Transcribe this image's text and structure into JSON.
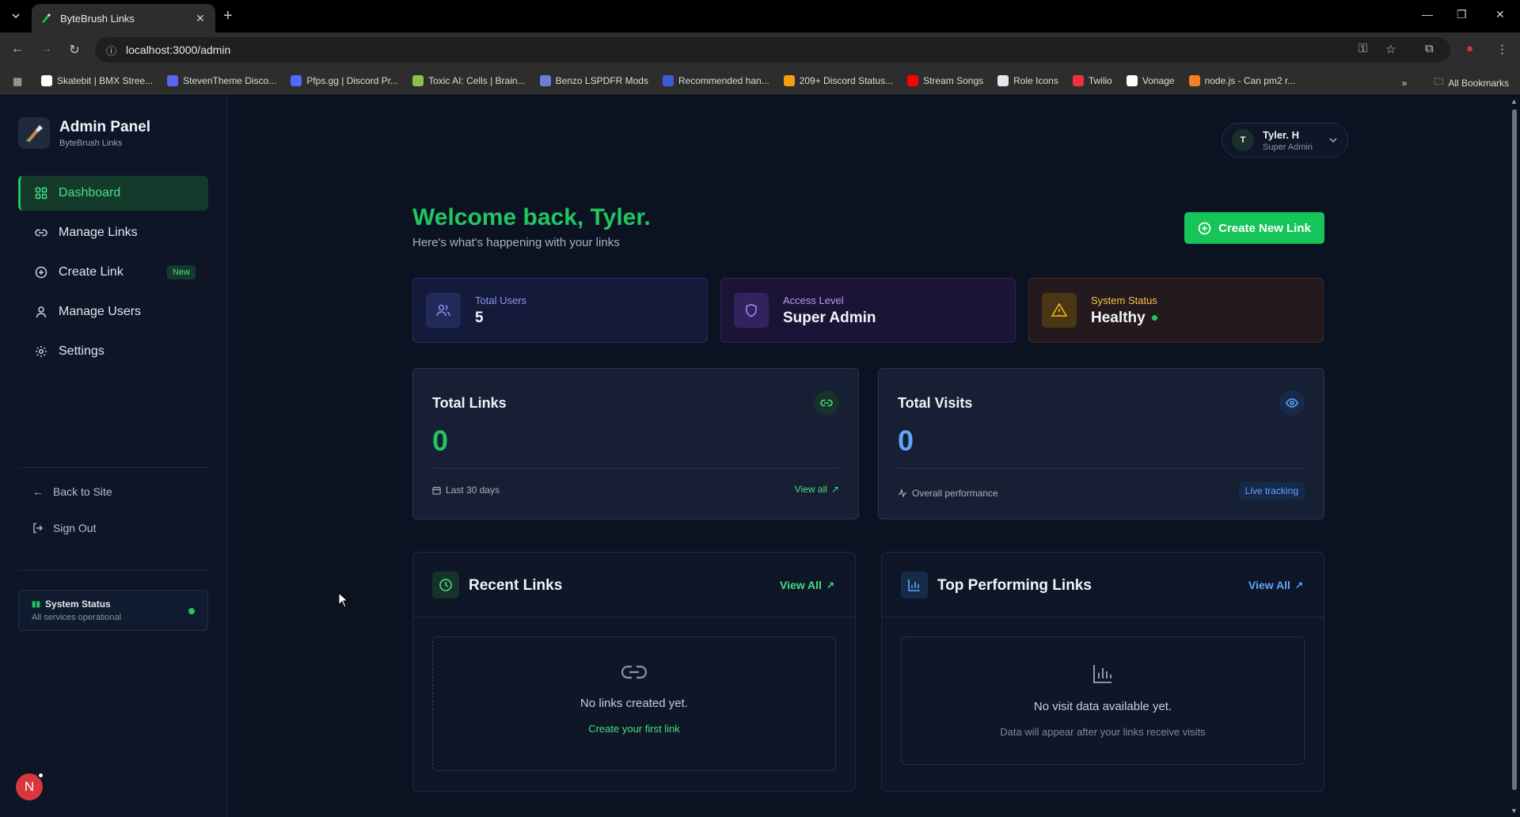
{
  "browser": {
    "tab_title": "ByteBrush Links",
    "url": "localhost:3000/admin",
    "bookmarks": [
      {
        "label": "Skatebit | BMX Stree...",
        "color": "#ffffff"
      },
      {
        "label": "StevenTheme Disco...",
        "color": "#5865f2"
      },
      {
        "label": "Pfps.gg | Discord Pr...",
        "color": "#4f6bff"
      },
      {
        "label": "Toxic AI: Cells | Brain...",
        "color": "#8bc34a"
      },
      {
        "label": "Benzo LSPDFR Mods",
        "color": "#6b7fd7"
      },
      {
        "label": "Recommended han...",
        "color": "#3b5bdb"
      },
      {
        "label": "209+ Discord Status...",
        "color": "#f59e0b"
      },
      {
        "label": "Stream Songs",
        "color": "#ff0000"
      },
      {
        "label": "Role Icons",
        "color": "#e5e7eb"
      },
      {
        "label": "Twilio",
        "color": "#f22f46"
      },
      {
        "label": "Vonage",
        "color": "#ffffff"
      },
      {
        "label": "node.js - Can pm2 r...",
        "color": "#f48024"
      }
    ],
    "all_bookmarks": "All Bookmarks"
  },
  "sidebar": {
    "brand_title": "Admin Panel",
    "brand_sub": "ByteBrush Links",
    "nav": [
      {
        "label": "Dashboard",
        "icon": "grid-icon",
        "active": true
      },
      {
        "label": "Manage Links",
        "icon": "link-icon"
      },
      {
        "label": "Create Link",
        "icon": "plus-circle-icon",
        "badge": "New"
      },
      {
        "label": "Manage Users",
        "icon": "user-icon"
      },
      {
        "label": "Settings",
        "icon": "gear-icon"
      }
    ],
    "back_to_site": "Back to Site",
    "sign_out": "Sign Out",
    "system_status_title": "System Status",
    "system_status_sub": "All services operational",
    "avatar_letter": "N"
  },
  "header": {
    "user_initial": "T",
    "user_name": "Tyler. H",
    "user_role": "Super Admin"
  },
  "main": {
    "welcome": "Welcome back, Tyler.",
    "welcome_sub": "Here's what's happening with your links",
    "create_button": "Create New Link",
    "stats": {
      "users_label": "Total Users",
      "users_value": "5",
      "access_label": "Access Level",
      "access_value": "Super Admin",
      "status_label": "System Status",
      "status_value": "Healthy"
    },
    "total_links": {
      "title": "Total Links",
      "value": "0",
      "footer": "Last 30 days",
      "link": "View all"
    },
    "total_visits": {
      "title": "Total Visits",
      "value": "0",
      "footer": "Overall performance",
      "badge": "Live tracking"
    },
    "recent_links": {
      "title": "Recent Links",
      "view_all": "View All",
      "empty_text": "No links created yet.",
      "empty_link": "Create your first link"
    },
    "top_links": {
      "title": "Top Performing Links",
      "view_all": "View All",
      "empty_text": "No visit data available yet.",
      "empty_sub": "Data will appear after your links receive visits"
    }
  },
  "colors": {
    "accent_green": "#22c55e",
    "accent_blue": "#60a5fa",
    "background": "#0b1222"
  }
}
